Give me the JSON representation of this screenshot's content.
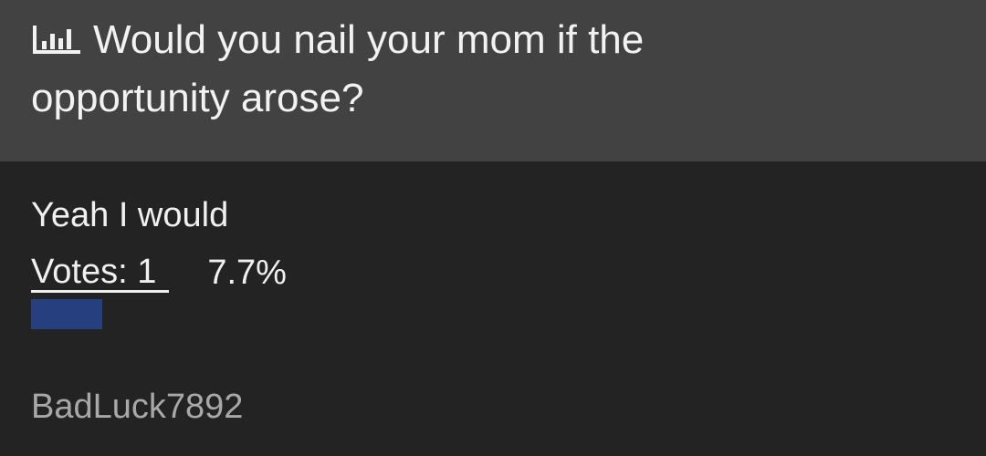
{
  "poll": {
    "question": "Would you nail your mom if the opportunity arose?",
    "icon": "bar-chart-icon",
    "options": [
      {
        "label": "Yeah I would",
        "votes_text": "Votes: 1",
        "percent_text": "7.7%",
        "percent": 7.7,
        "bar_color": "#26407f"
      }
    ],
    "author": "BadLuck7892"
  },
  "colors": {
    "header_background": "#424242",
    "body_background": "#232323",
    "text": "#f0f0f0",
    "muted_text": "#a8a8a8"
  }
}
